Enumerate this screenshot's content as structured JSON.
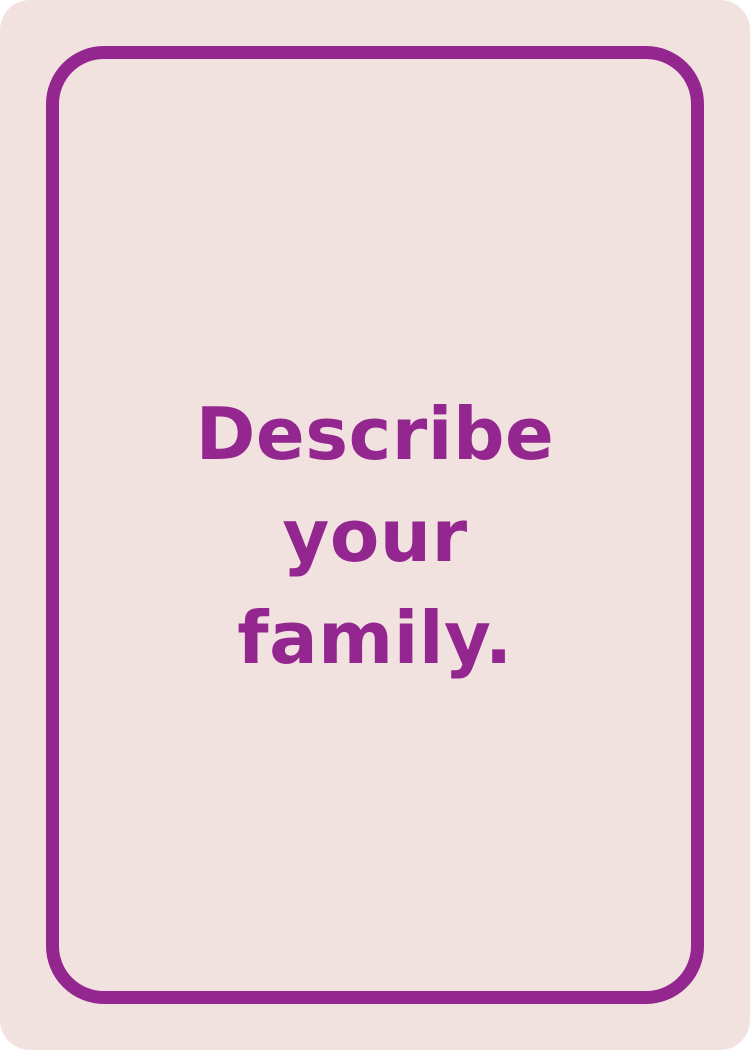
{
  "card": {
    "prompt_lines": [
      "Describe",
      "your",
      "family."
    ],
    "colors": {
      "background": "#f2e2df",
      "accent": "#93278f"
    }
  }
}
